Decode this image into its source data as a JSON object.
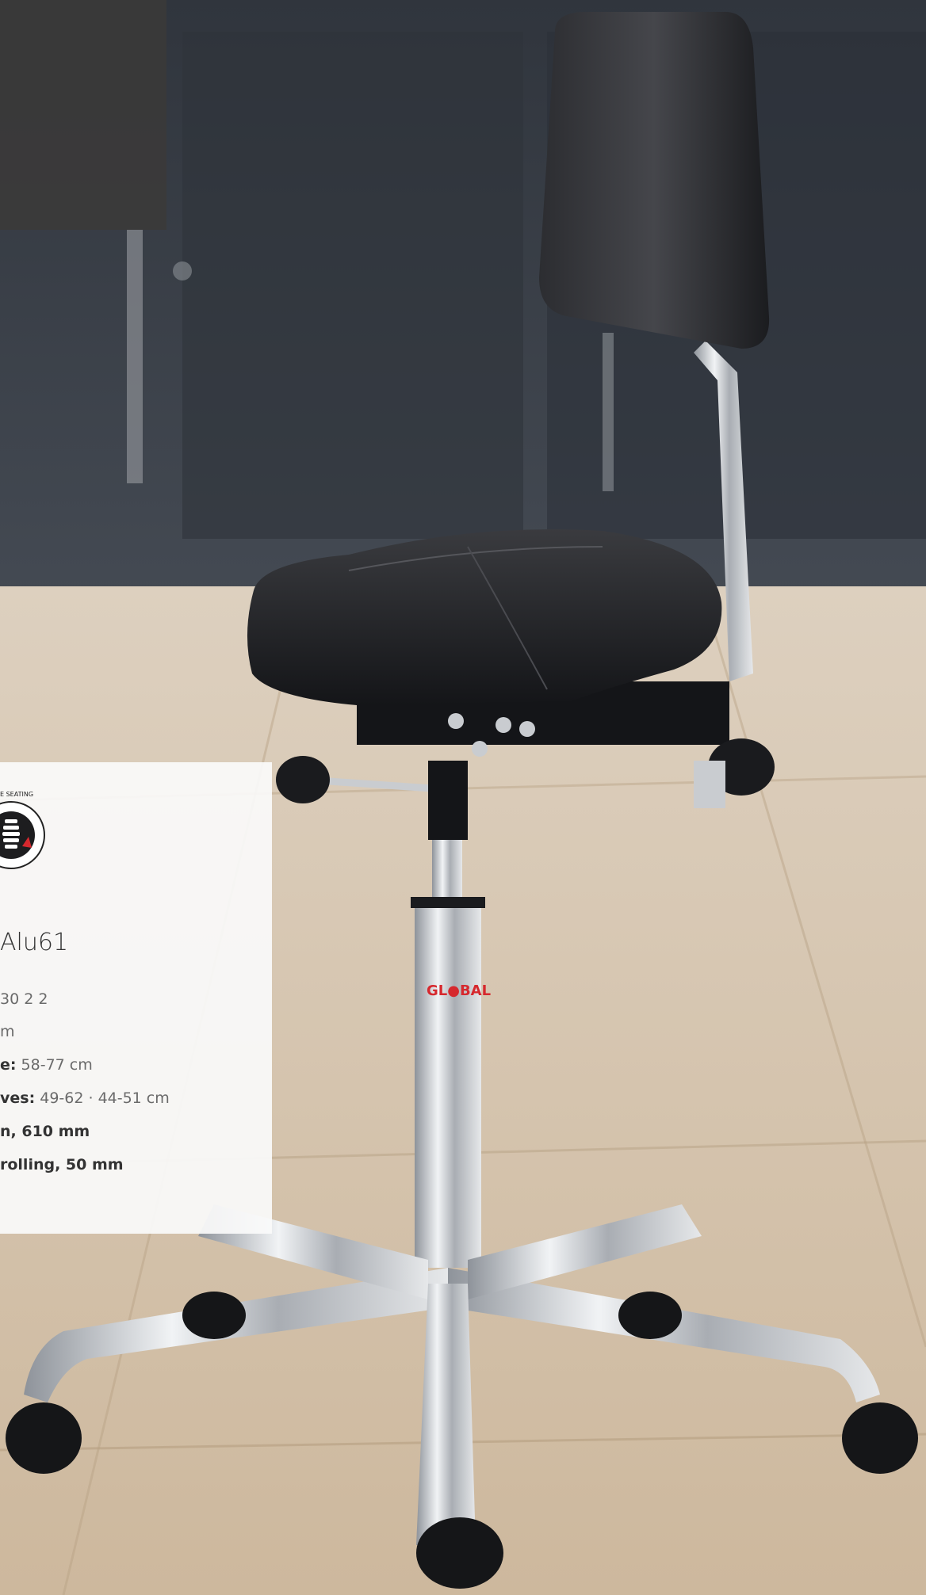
{
  "badge": {
    "ring_text": "E SEATING"
  },
  "product": {
    "model": "Alu61",
    "article": "30 2 2",
    "dimension": "m",
    "seat_height_label": "e:",
    "seat_height_value": "58-77 cm",
    "sleeves_label": "ves:",
    "sleeves_value": "49-62 · 44-51 cm",
    "gas_lift": "n, 610 mm",
    "castors": "rolling, 50 mm"
  },
  "brand": {
    "logo_text": "GL●BAL"
  },
  "colors": {
    "wall": "#3a3f47",
    "floor": "#d9c6ad",
    "seat": "#1e1f22",
    "chrome": "#c9ccd0",
    "logo_red": "#d6282e"
  }
}
